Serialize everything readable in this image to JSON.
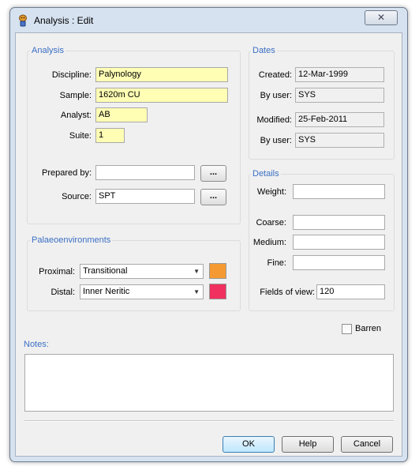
{
  "window": {
    "title": "Analysis : Edit",
    "close_label": "✕"
  },
  "analysis": {
    "group_label": "Analysis",
    "discipline_label": "Discipline:",
    "discipline_value": "Palynology",
    "sample_label": "Sample:",
    "sample_value": "1620m CU",
    "analyst_label": "Analyst:",
    "analyst_value": "AB",
    "suite_label": "Suite:",
    "suite_value": "1",
    "prepared_by_label": "Prepared by:",
    "prepared_by_value": "",
    "source_label": "Source:",
    "source_value": "SPT",
    "browse_label": "..."
  },
  "dates": {
    "group_label": "Dates",
    "created_label": "Created:",
    "created_value": "12-Mar-1999",
    "created_by_label": "By user:",
    "created_by_value": "SYS",
    "modified_label": "Modified:",
    "modified_value": "25-Feb-2011",
    "modified_by_label": "By user:",
    "modified_by_value": "SYS"
  },
  "palaeo": {
    "group_label": "Palaeoenvironments",
    "proximal_label": "Proximal:",
    "proximal_value": "Transitional",
    "proximal_color": "#f59a32",
    "distal_label": "Distal:",
    "distal_value": "Inner Neritic",
    "distal_color": "#f0305e"
  },
  "details": {
    "group_label": "Details",
    "weight_label": "Weight:",
    "weight_value": "",
    "coarse_label": "Coarse:",
    "coarse_value": "",
    "medium_label": "Medium:",
    "medium_value": "",
    "fine_label": "Fine:",
    "fine_value": "",
    "fields_label": "Fields of view:",
    "fields_value": "120"
  },
  "barren": {
    "label": "Barren",
    "checked": false
  },
  "notes": {
    "label": "Notes:",
    "value": ""
  },
  "buttons": {
    "ok": "OK",
    "help": "Help",
    "cancel": "Cancel"
  }
}
